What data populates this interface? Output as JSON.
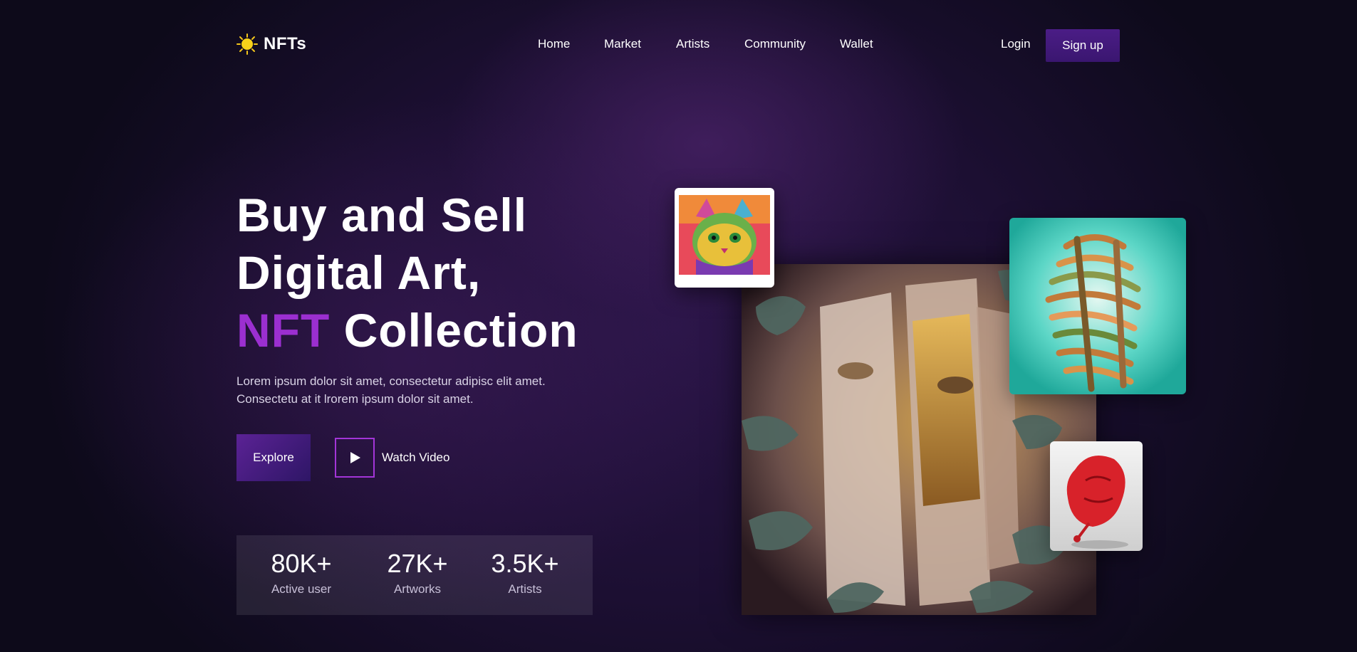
{
  "header": {
    "logo_text": "NFTs",
    "nav": [
      "Home",
      "Market",
      "Artists",
      "Community",
      "Wallet"
    ],
    "login_label": "Login",
    "signup_label": "Sign up"
  },
  "hero": {
    "title_line1": "Buy and Sell",
    "title_line2": "Digital Art,",
    "title_highlight": "NFT",
    "title_line3_rest": " Collection",
    "description_line1": "Lorem ipsum dolor sit amet, consectetur adipisc elit amet.",
    "description_line2": "Consectetu at it lrorem ipsum dolor sit amet.",
    "explore_label": "Explore",
    "watch_label": "Watch Video"
  },
  "stats": [
    {
      "value": "80K+",
      "label": "Active user"
    },
    {
      "value": "27K+",
      "label": "Artworks"
    },
    {
      "value": "3.5K+",
      "label": "Artists"
    }
  ],
  "colors": {
    "accent": "#9b2fd0",
    "button": "#4b1d86",
    "background": "#1c0f32"
  },
  "icons": {
    "logo": "sun-icon",
    "play": "play-icon"
  }
}
